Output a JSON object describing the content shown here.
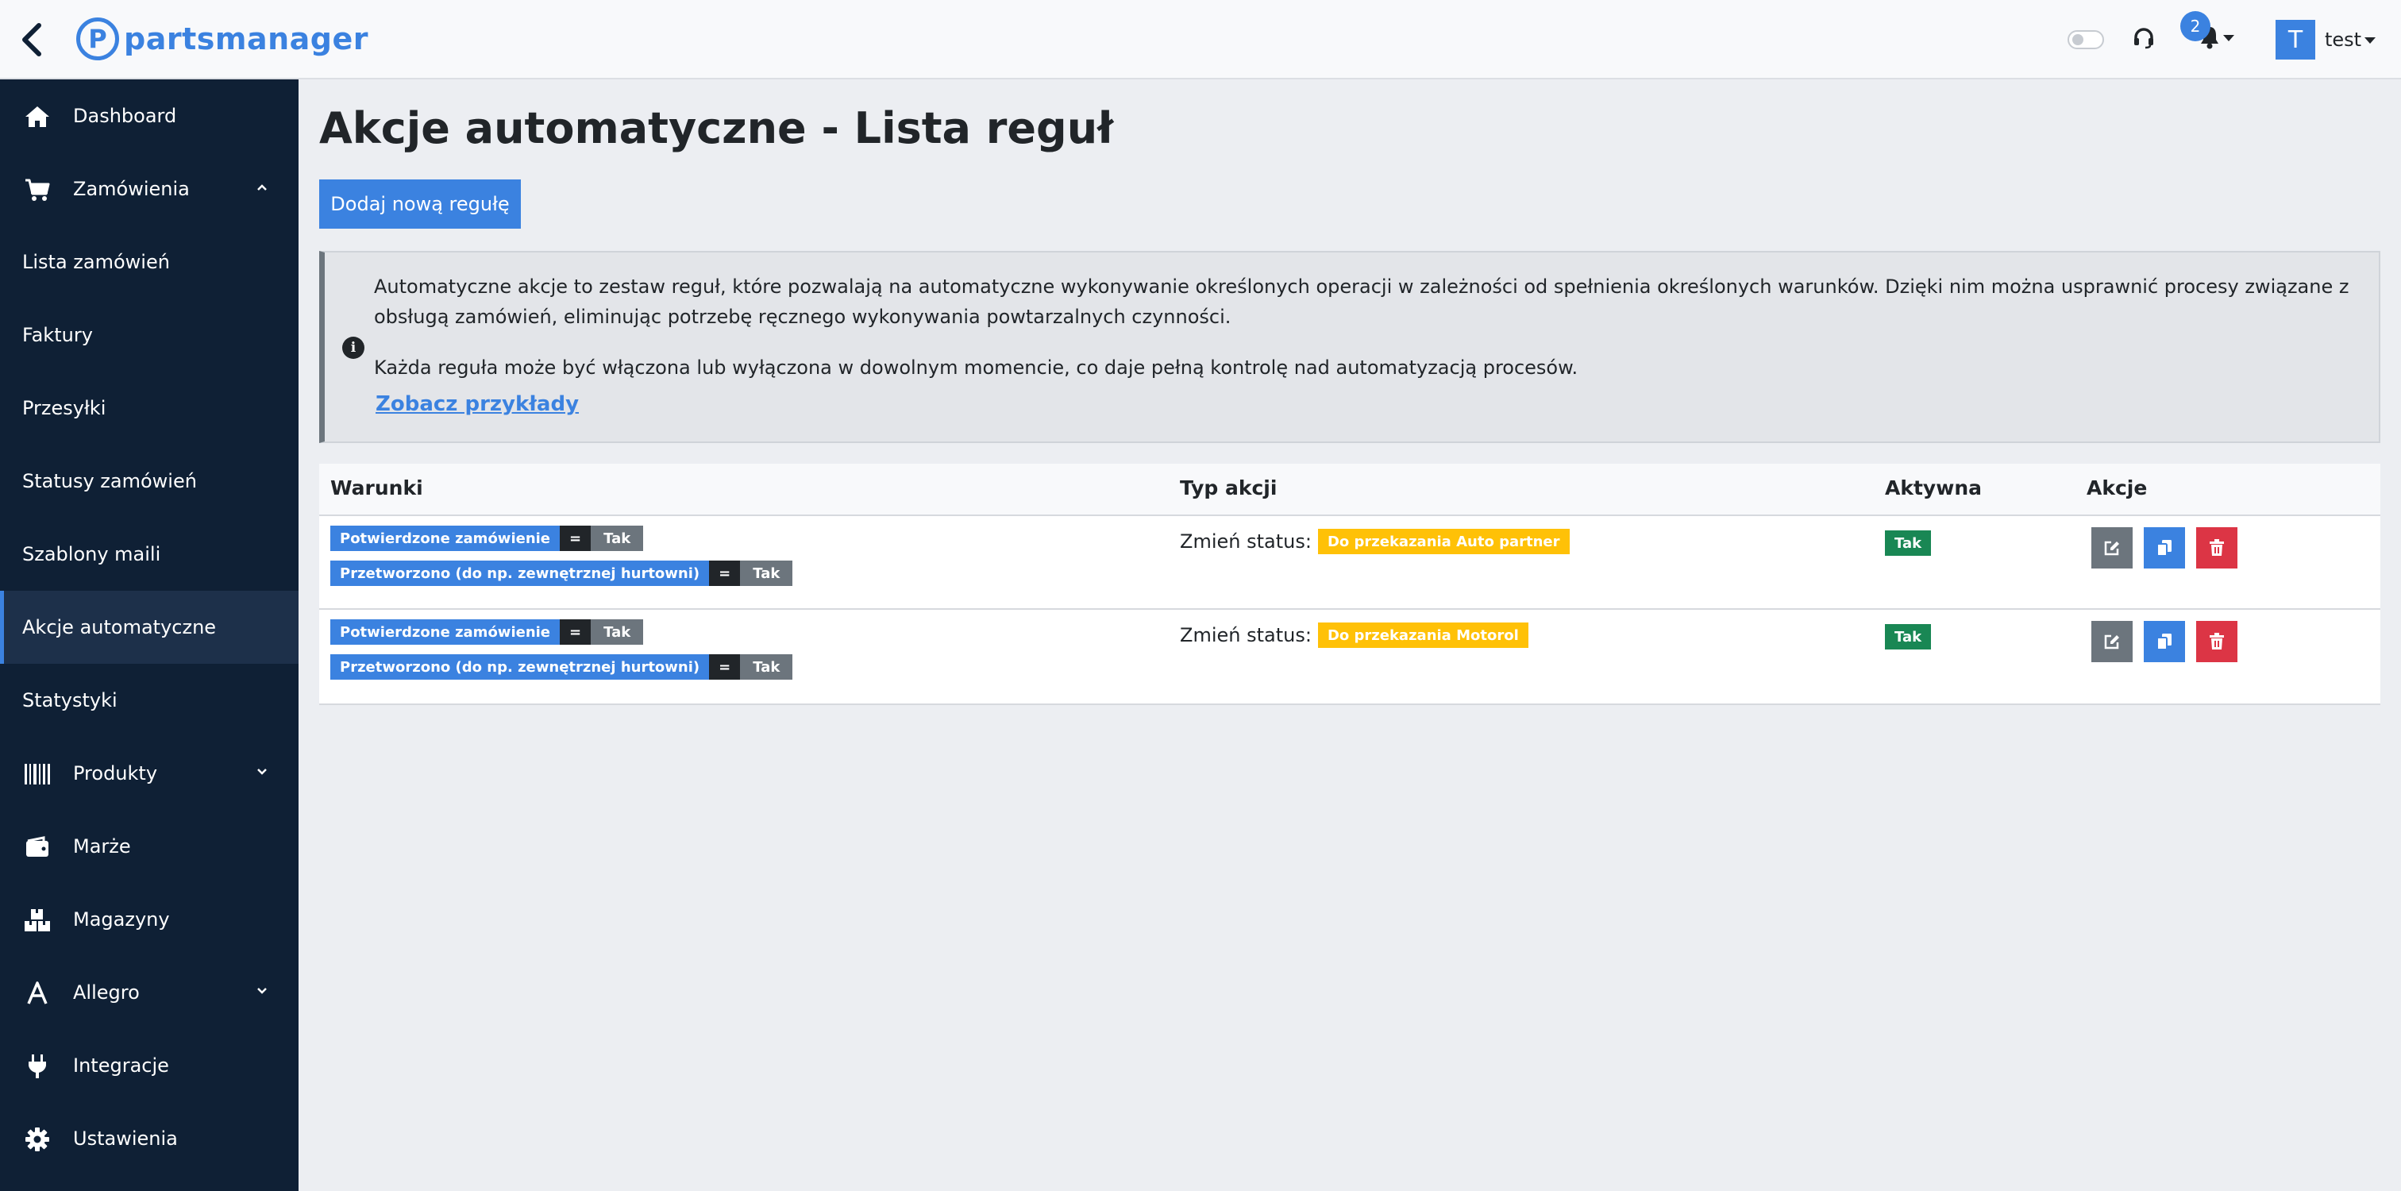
{
  "header": {
    "back_icon": "chevron-left-icon",
    "logo_text": "partsmanager",
    "notification_count": "2",
    "user_initial": "T",
    "user_name": "test"
  },
  "sidebar": {
    "items": [
      {
        "label": "Dashboard",
        "icon": "home-icon"
      },
      {
        "label": "Zamówienia",
        "icon": "cart-icon",
        "expanded": true
      },
      {
        "label": "Lista zamówień"
      },
      {
        "label": "Faktury"
      },
      {
        "label": "Przesyłki"
      },
      {
        "label": "Statusy zamówień"
      },
      {
        "label": "Szablony maili"
      },
      {
        "label": "Akcje automatyczne",
        "active": true
      },
      {
        "label": "Statystyki"
      },
      {
        "label": "Produkty",
        "icon": "barcode-icon",
        "expanded": false
      },
      {
        "label": "Marże",
        "icon": "wallet-icon"
      },
      {
        "label": "Magazyny",
        "icon": "boxes-icon"
      },
      {
        "label": "Allegro",
        "icon": "allegro-icon",
        "expanded": false
      },
      {
        "label": "Integracje",
        "icon": "plug-icon"
      },
      {
        "label": "Ustawienia",
        "icon": "gear-icon"
      }
    ]
  },
  "main": {
    "title": "Akcje automatyczne - Lista reguł",
    "add_button": "Dodaj nową regułę",
    "info": {
      "paragraph1": "Automatyczne akcje to zestaw reguł, które pozwalają na automatyczne wykonywanie określonych operacji w zależności od spełnienia określonych warunków. Dzięki nim można usprawnić procesy związane z obsługą zamówień, eliminując potrzebę ręcznego wykonywania powtarzalnych czynności.",
      "paragraph2": "Każda reguła może być włączona lub wyłączona w dowolnym momencie, co daje pełną kontrolę nad automatyzacją procesów.",
      "link": "Zobacz przykłady"
    },
    "table": {
      "headers": {
        "conditions": "Warunki",
        "action_type": "Typ akcji",
        "active": "Aktywna",
        "actions": "Akcje"
      },
      "rows": [
        {
          "conditions": [
            {
              "name": "Potwierdzone zamówienie",
              "op": "=",
              "value": "Tak"
            },
            {
              "name": "Przetworzono (do np. zewnętrznej hurtowni)",
              "op": "=",
              "value": "Tak"
            }
          ],
          "action_label": "Zmień status:",
          "status": "Do przekazania Auto partner",
          "active": "Tak"
        },
        {
          "conditions": [
            {
              "name": "Potwierdzone zamówienie",
              "op": "=",
              "value": "Tak"
            },
            {
              "name": "Przetworzono (do np. zewnętrznej hurtowni)",
              "op": "=",
              "value": "Tak"
            }
          ],
          "action_label": "Zmień status:",
          "status": "Do przekazania Motorol",
          "active": "Tak"
        }
      ]
    }
  },
  "colors": {
    "accent": "#3b82e0",
    "sidebar": "#0f2035",
    "warning": "#ffc107",
    "success": "#198754",
    "danger": "#dc3545",
    "secondary": "#6c757d"
  }
}
